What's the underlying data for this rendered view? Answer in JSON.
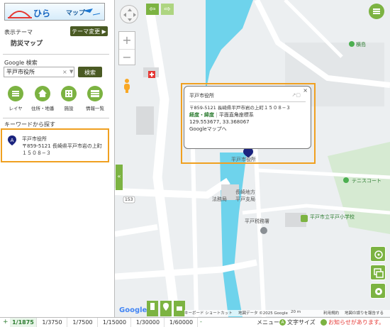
{
  "logo": {
    "text": "マップ"
  },
  "theme": {
    "heading": "表示テーマ",
    "name": "防災マップ",
    "change_button": "テーマ変更 ▶"
  },
  "search": {
    "label": "Google 検索",
    "value": "平戸市役所",
    "button": "検索"
  },
  "tools": [
    {
      "label": "レイヤ",
      "icon": "layers-icon"
    },
    {
      "label": "住所・地番",
      "icon": "home-icon"
    },
    {
      "label": "施設",
      "icon": "building-icon"
    },
    {
      "label": "情報一覧",
      "icon": "list-icon"
    }
  ],
  "keyword": {
    "heading": "キーワードから探す",
    "result_name": "平戸市役所",
    "result_addr1": "〒859-5121 長崎県平戸市岩の上町",
    "result_addr2": "１５０８−３"
  },
  "popup": {
    "title": "平戸市役所",
    "address": "〒859-5121 長崎県平戸市岩の上町１５０８−３",
    "coord_label": "経度・緯度",
    "coord_system": "平面直角座標系",
    "coords": "129.553677, 33.368067",
    "gmap_link": "Googleマップへ",
    "close": "×"
  },
  "map_labels": {
    "marker": "平戸市役所",
    "yokoshima": "横島",
    "tennis": "テニスコート",
    "court": "長崎地方",
    "court2": "平戸支局",
    "legal": "法務局",
    "tax": "平戸税務署",
    "school": "平戸市立平戸小学校",
    "road153": "153"
  },
  "attribution": {
    "google": "Google",
    "shortcuts": "キーボード ショートカット",
    "mapdata": "地図データ ©2025 Google",
    "scale": "20 m",
    "terms": "利用規約",
    "report": "地図の誤りを報告する"
  },
  "scales": [
    "1/1875",
    "1/3750",
    "1/7500",
    "1/15000",
    "1/30000",
    "1/60000"
  ],
  "status": {
    "menu": "メニュー",
    "textsize": "文字サイズ",
    "notice": "お知らせがあります。"
  }
}
